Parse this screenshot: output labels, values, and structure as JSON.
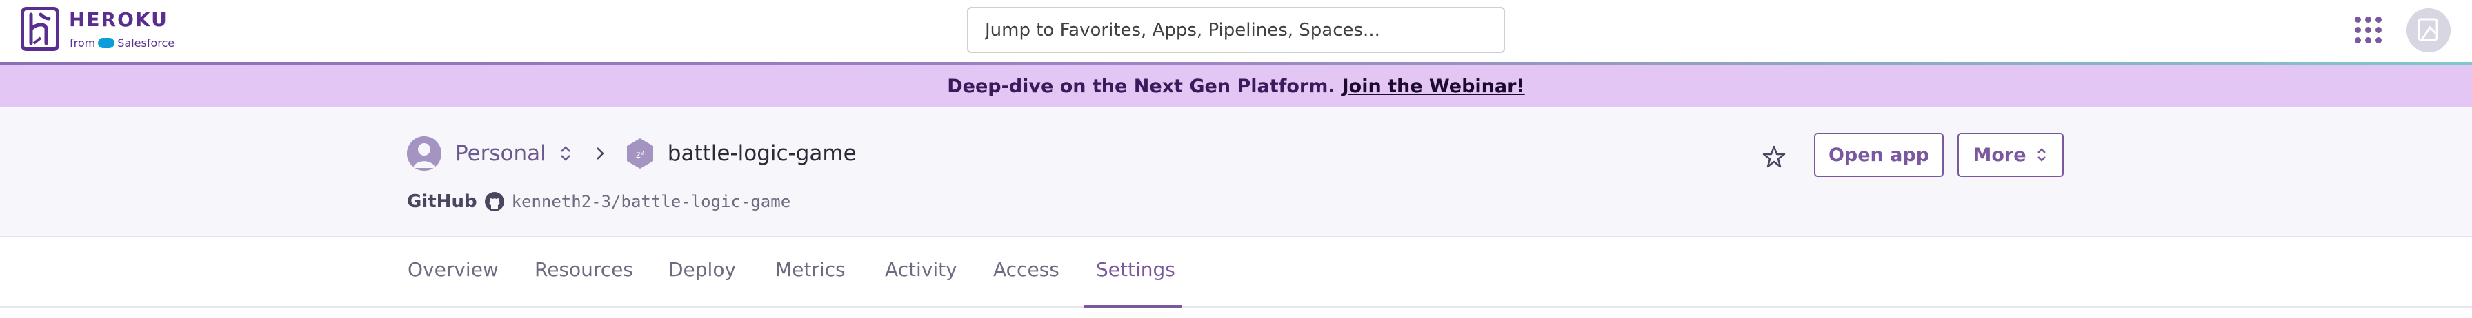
{
  "brand": {
    "name": "HEROKU",
    "from_text": "from",
    "partner": "Salesforce",
    "accent_color": "#79589f"
  },
  "header": {
    "search_placeholder": "Jump to Favorites, Apps, Pipelines, Spaces...",
    "apps_icon": "grid-icon",
    "avatar_icon": "user-avatar-icon"
  },
  "banner": {
    "text": "Deep-dive on the Next Gen Platform.",
    "link": "Join the Webinar!",
    "background": "#e4c6f4"
  },
  "app": {
    "account": "Personal",
    "name": "battle-logic-game",
    "source_label": "GitHub",
    "repo": "kenneth2-3/battle-logic-game"
  },
  "actions": {
    "open_app": "Open app",
    "more": "More"
  },
  "tabs": [
    {
      "label": "Overview",
      "active": false
    },
    {
      "label": "Resources",
      "active": false
    },
    {
      "label": "Deploy",
      "active": false
    },
    {
      "label": "Metrics",
      "active": false
    },
    {
      "label": "Activity",
      "active": false
    },
    {
      "label": "Access",
      "active": false
    },
    {
      "label": "Settings",
      "active": true
    }
  ]
}
